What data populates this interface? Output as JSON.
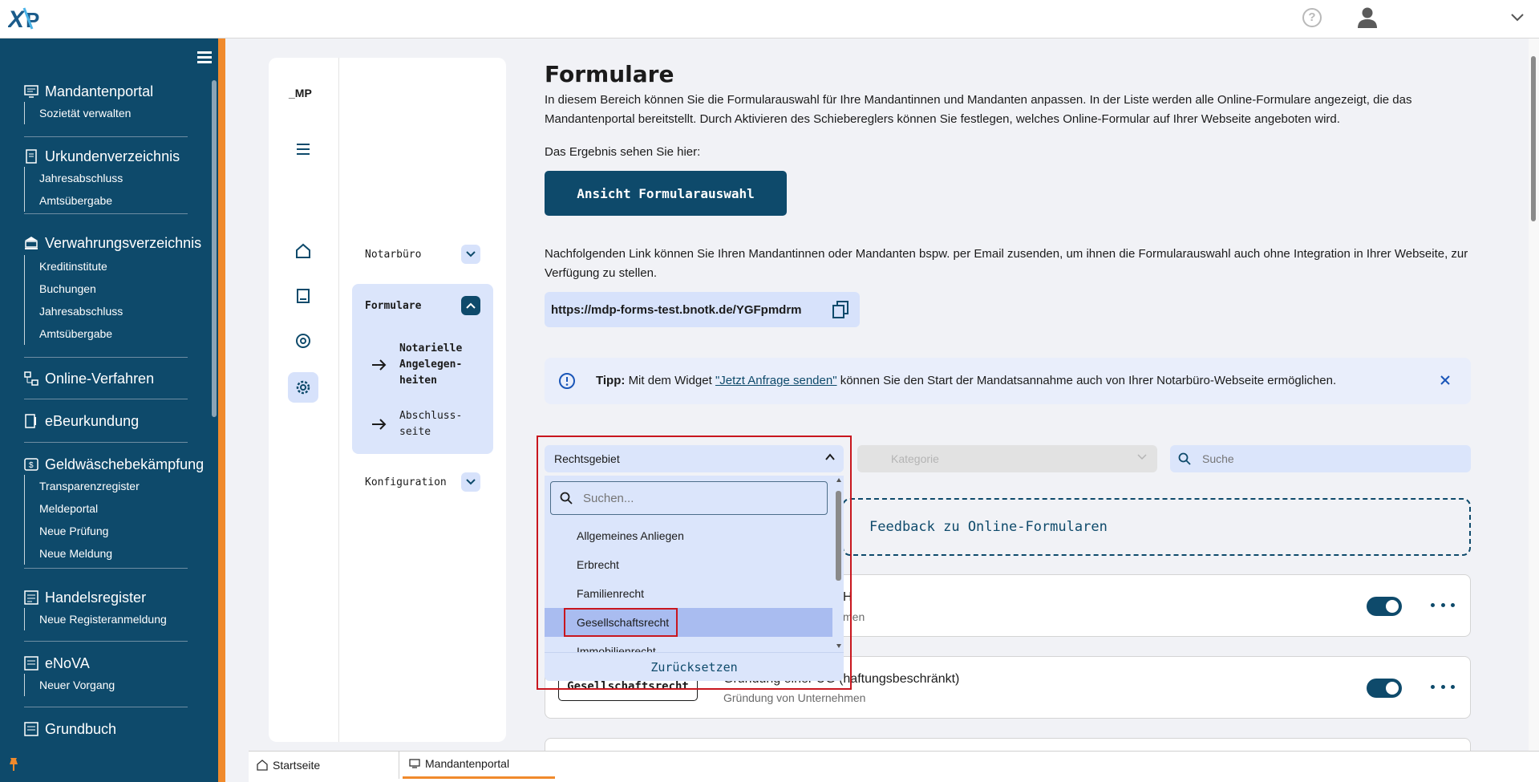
{
  "topbar": {
    "logo_text": "XNP"
  },
  "sidebar": {
    "sections": [
      {
        "title": "Mandantenportal",
        "items": [
          "Sozietät verwalten"
        ]
      },
      {
        "title": "Urkundenverzeichnis",
        "items": [
          "Jahresabschluss",
          "Amtsübergabe"
        ]
      },
      {
        "title": "Verwahrungsverzeichnis",
        "items": [
          "Kreditinstitute",
          "Buchungen",
          "Jahresabschluss",
          "Amtsübergabe"
        ]
      },
      {
        "title": "Online-Verfahren",
        "items": []
      },
      {
        "title": "eBeurkundung",
        "items": []
      },
      {
        "title": "Geldwäschebekämpfung",
        "items": [
          "Transparenzregister",
          "Meldeportal",
          "Neue Prüfung",
          "Neue Meldung"
        ]
      },
      {
        "title": "Handelsregister",
        "items": [
          "Neue Registeranmeldung"
        ]
      },
      {
        "title": "eNoVA",
        "items": [
          "Neuer Vorgang"
        ]
      },
      {
        "title": "Grundbuch",
        "items": []
      }
    ]
  },
  "subnav": {
    "logo": "_MP",
    "notarbuero": "Notarbüro",
    "formulare": "Formulare",
    "sub_items": [
      "Notarielle Angelegen-heiten",
      "Abschluss-seite"
    ],
    "konfiguration": "Konfiguration"
  },
  "main": {
    "title": "Formulare",
    "intro": "In diesem Bereich können Sie die Formularauswahl für Ihre Mandantinnen und Mandanten anpassen. In der Liste werden alle Online-Formulare angezeigt, die das Mandantenportal bereitstellt. Durch Aktivieren des Schiebereglers können Sie festlegen, welches Online-Formular auf Ihrer Webseite angeboten wird.",
    "result_label": "Das Ergebnis sehen Sie hier:",
    "view_button": "Ansicht Formularauswahl",
    "link_intro": "Nachfolgenden Link können Sie Ihren Mandantinnen oder Mandanten bspw. per Email zusenden, um ihnen die Formularauswahl auch ohne Integration in Ihrer Webseite, zur Verfügung zu stellen.",
    "link_url": "https://mdp-forms-test.bnotk.de/YGFpmdrm",
    "tip_bold": "Tipp:",
    "tip_pre": "Mit dem Widget",
    "tip_link": "\"Jetzt Anfrage senden\"",
    "tip_post": "können Sie den Start der Mandatsannahme auch von Ihrer Notarbüro-Webseite ermöglichen.",
    "filter_category": "Kategorie",
    "filter_search": "Suche",
    "feedback": "Feedback zu Online-Formularen",
    "card1_title_fragment": "H",
    "card1_sub_fragment": "men",
    "card2_tag": "Gesellschaftsrecht",
    "card2_title": "Gründung einer UG (haftungsbeschränkt)",
    "card2_sub": "Gründung von Unternehmen"
  },
  "dropdown": {
    "label": "Rechtsgebiet",
    "search_placeholder": "Suchen...",
    "options": [
      "Allgemeines Anliegen",
      "Erbrecht",
      "Familienrecht",
      "Gesellschaftsrecht",
      "Immobilienrecht"
    ],
    "selected": "Gesellschaftsrecht",
    "reset": "Zurücksetzen"
  },
  "bottom_tabs": [
    "Startseite",
    "Mandantenportal"
  ],
  "colors": {
    "primary": "#0e4a6b",
    "accent": "#f08a2c",
    "light": "#dbe5fb",
    "highlight": "#c8161e"
  }
}
